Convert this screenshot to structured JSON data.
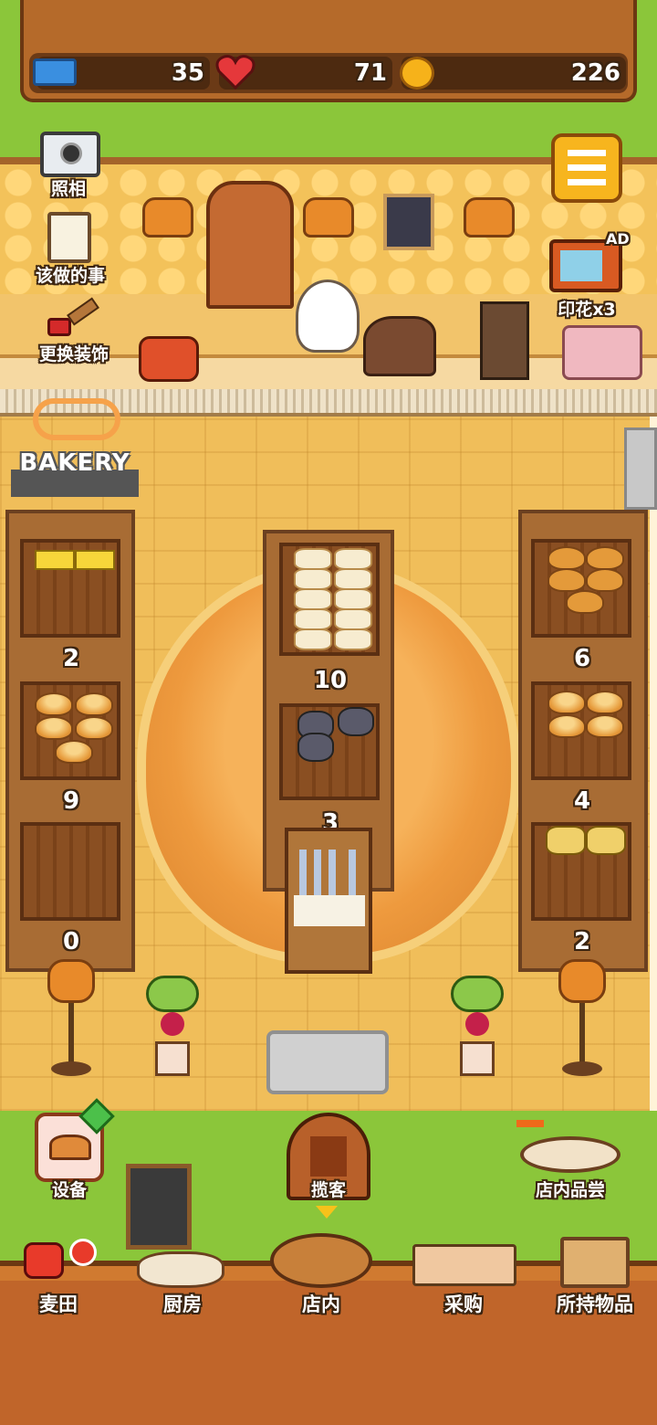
{
  "stats": {
    "tickets": "35",
    "hearts": "71",
    "coins": "226"
  },
  "side_actions": [
    {
      "icon": "camera-icon",
      "label": "照相"
    },
    {
      "icon": "clipboard-icon",
      "label": "该做的事"
    },
    {
      "icon": "paint-brush-icon",
      "label": "更换装饰"
    }
  ],
  "ad_tv": {
    "badge": "AD",
    "label": "印花x3"
  },
  "shop_sign": "BAKERY",
  "shelves": {
    "left": [
      "2",
      "9",
      "0"
    ],
    "center": [
      "10",
      "3"
    ],
    "right": [
      "6",
      "4",
      "2"
    ]
  },
  "quick_actions": {
    "equipment": "设备",
    "attract": "揽客",
    "taste": "店内品尝"
  },
  "nav": [
    {
      "icon": "wheat-field-icon",
      "label": "麦田"
    },
    {
      "icon": "kitchen-icon",
      "label": "厨房"
    },
    {
      "icon": "store-icon",
      "label": "店内"
    },
    {
      "icon": "purchase-icon",
      "label": "采购"
    },
    {
      "icon": "inventory-box-icon",
      "label": "所持物品"
    }
  ],
  "colors": {
    "accent": "#f5a623",
    "wood": "#a86c34",
    "grass": "#8bc63a"
  }
}
